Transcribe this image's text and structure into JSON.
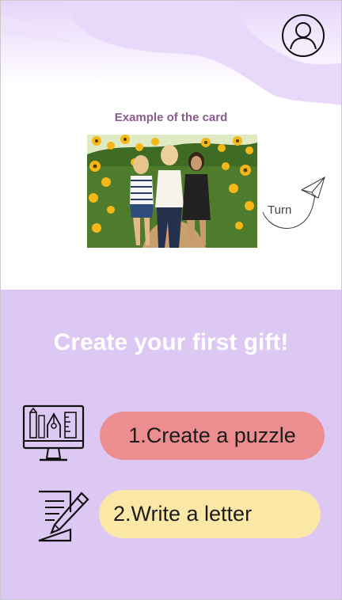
{
  "header": {
    "profile_icon": "user-circle-icon"
  },
  "card": {
    "caption": "Example of the card",
    "photo_description": "three women smiling in a sunflower field",
    "turn_label": "Turn",
    "turn_icon": "paper-plane-icon"
  },
  "main": {
    "headline": "Create your first gift!",
    "actions": [
      {
        "label": "1.Create a puzzle",
        "icon": "design-monitor-icon",
        "color": "#ec8d90"
      },
      {
        "label": "2.Write a letter",
        "icon": "write-letter-icon",
        "color": "#fbe8a6"
      }
    ]
  },
  "colors": {
    "accent_background": "#ddc7f3",
    "caption": "#8a5a8e"
  }
}
